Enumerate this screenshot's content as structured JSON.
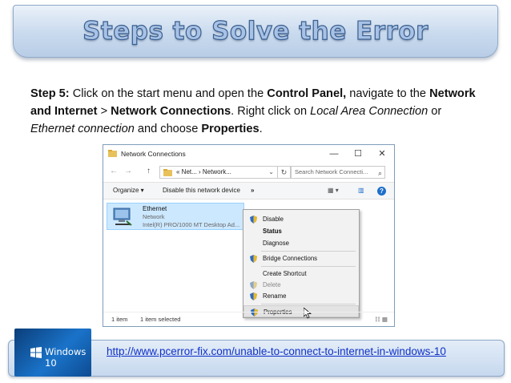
{
  "banner": {
    "title": "Steps to Solve the Error"
  },
  "instructions": {
    "step_label": "Step 5:",
    "t1": " Click on the start menu and open the ",
    "control_panel": "Control Panel,",
    "t2": " navigate to the ",
    "network_internet": "Network and Internet",
    "t3": " > ",
    "network_connections": "Network Connections",
    "t4": ". Right click on ",
    "local_area": "Local Area Connection",
    "t5": " or ",
    "ethernet_conn": "Ethernet connection",
    "t6": " and choose ",
    "properties": "Properties",
    "t7": "."
  },
  "window": {
    "title": "Network Connections",
    "controls": {
      "minimize": "—",
      "maximize": "☐",
      "close": "✕"
    },
    "nav": {
      "back": "←",
      "forward": "→",
      "up": "↑"
    },
    "address": "« Net... › Network...",
    "address_dropdown": "⌄",
    "refresh": "↻",
    "search_placeholder": "Search Network Connecti...",
    "search_icon": "⌕",
    "toolbar": {
      "organize": "Organize ▾",
      "disable_device": "Disable this network device",
      "more": "»",
      "view": "▦ ▾",
      "pane": "▥"
    },
    "help": "?",
    "item": {
      "name": "Ethernet",
      "type": "Network",
      "adapter": "Intel(R) PRO/1000 MT Desktop Ad..."
    },
    "menu": {
      "disable": "Disable",
      "status": "Status",
      "diagnose": "Diagnose",
      "bridge": "Bridge Connections",
      "shortcut": "Create Shortcut",
      "delete": "Delete",
      "rename": "Rename",
      "properties": "Properties"
    },
    "status": {
      "count": "1 item",
      "selected": "1 item selected",
      "views": "☷ ▦"
    }
  },
  "footer": {
    "logo_text": "Windows 10",
    "link": "http://www.pcerror-fix.com/unable-to-connect-to-internet-in-windows-10"
  },
  "colors": {
    "banner": "#c9daee",
    "link": "#1030c8",
    "selection": "#cce8ff",
    "logo": "#1a73c9"
  }
}
